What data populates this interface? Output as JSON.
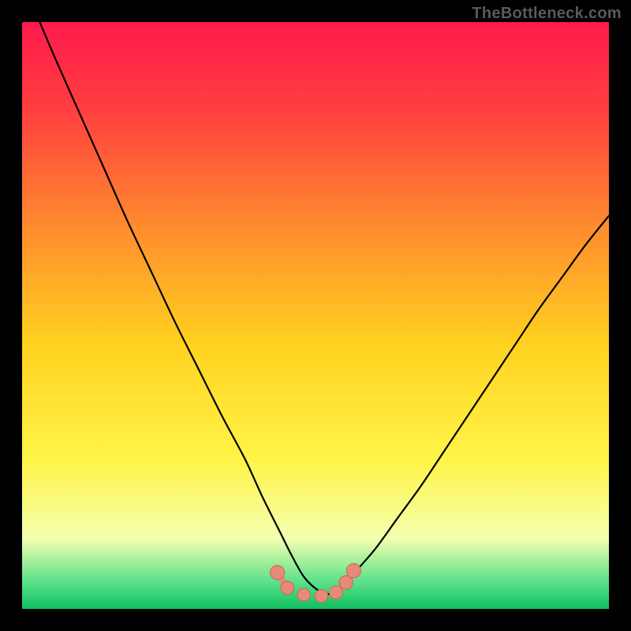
{
  "watermark": "TheBottleneck.com",
  "chart_data": {
    "type": "line",
    "title": "",
    "xlabel": "",
    "ylabel": "",
    "xlim": [
      0,
      100
    ],
    "ylim": [
      0,
      100
    ],
    "background_gradient": {
      "stops": [
        {
          "offset": 0.0,
          "color": "#ff1a4d"
        },
        {
          "offset": 0.15,
          "color": "#ff3f3f"
        },
        {
          "offset": 0.35,
          "color": "#ff8c2e"
        },
        {
          "offset": 0.55,
          "color": "#ffd21f"
        },
        {
          "offset": 0.75,
          "color": "#fff54a"
        },
        {
          "offset": 0.88,
          "color": "#f4ffb0"
        },
        {
          "offset": 0.955,
          "color": "#58e08a"
        },
        {
          "offset": 1.0,
          "color": "#10c060"
        }
      ]
    },
    "series": [
      {
        "name": "bottleneck-curve",
        "color": "#000000",
        "width": 2.2,
        "x": [
          3,
          6,
          10,
          14,
          18,
          22,
          26,
          30,
          34,
          38,
          41,
          44,
          46,
          48,
          50,
          52,
          54,
          56,
          60,
          64,
          68,
          72,
          76,
          80,
          84,
          88,
          92,
          96,
          100
        ],
        "y": [
          100,
          93,
          84,
          75,
          66,
          57.5,
          49,
          41,
          33,
          25.5,
          19,
          13,
          9,
          5.5,
          3.5,
          2.5,
          3.5,
          5.5,
          10,
          15.5,
          21,
          27,
          33,
          39,
          45,
          51,
          56.5,
          62,
          67
        ]
      }
    ],
    "bottom_markers": {
      "color": "#e88a7a",
      "stroke": "#d46a56",
      "dots": [
        {
          "x": 43.5,
          "y": 6.2,
          "r": 4.5
        },
        {
          "x": 45.2,
          "y": 3.6,
          "r": 4.0
        },
        {
          "x": 48.0,
          "y": 2.4,
          "r": 3.8
        },
        {
          "x": 51.0,
          "y": 2.2,
          "r": 3.8
        },
        {
          "x": 53.5,
          "y": 2.8,
          "r": 4.0
        },
        {
          "x": 55.2,
          "y": 4.5,
          "r": 4.2
        },
        {
          "x": 56.5,
          "y": 6.5,
          "r": 4.5
        }
      ],
      "links": [
        [
          43.5,
          6.2,
          45.2,
          3.6
        ],
        [
          53.5,
          2.8,
          55.2,
          4.5
        ],
        [
          55.2,
          4.5,
          56.5,
          6.5
        ]
      ]
    }
  }
}
